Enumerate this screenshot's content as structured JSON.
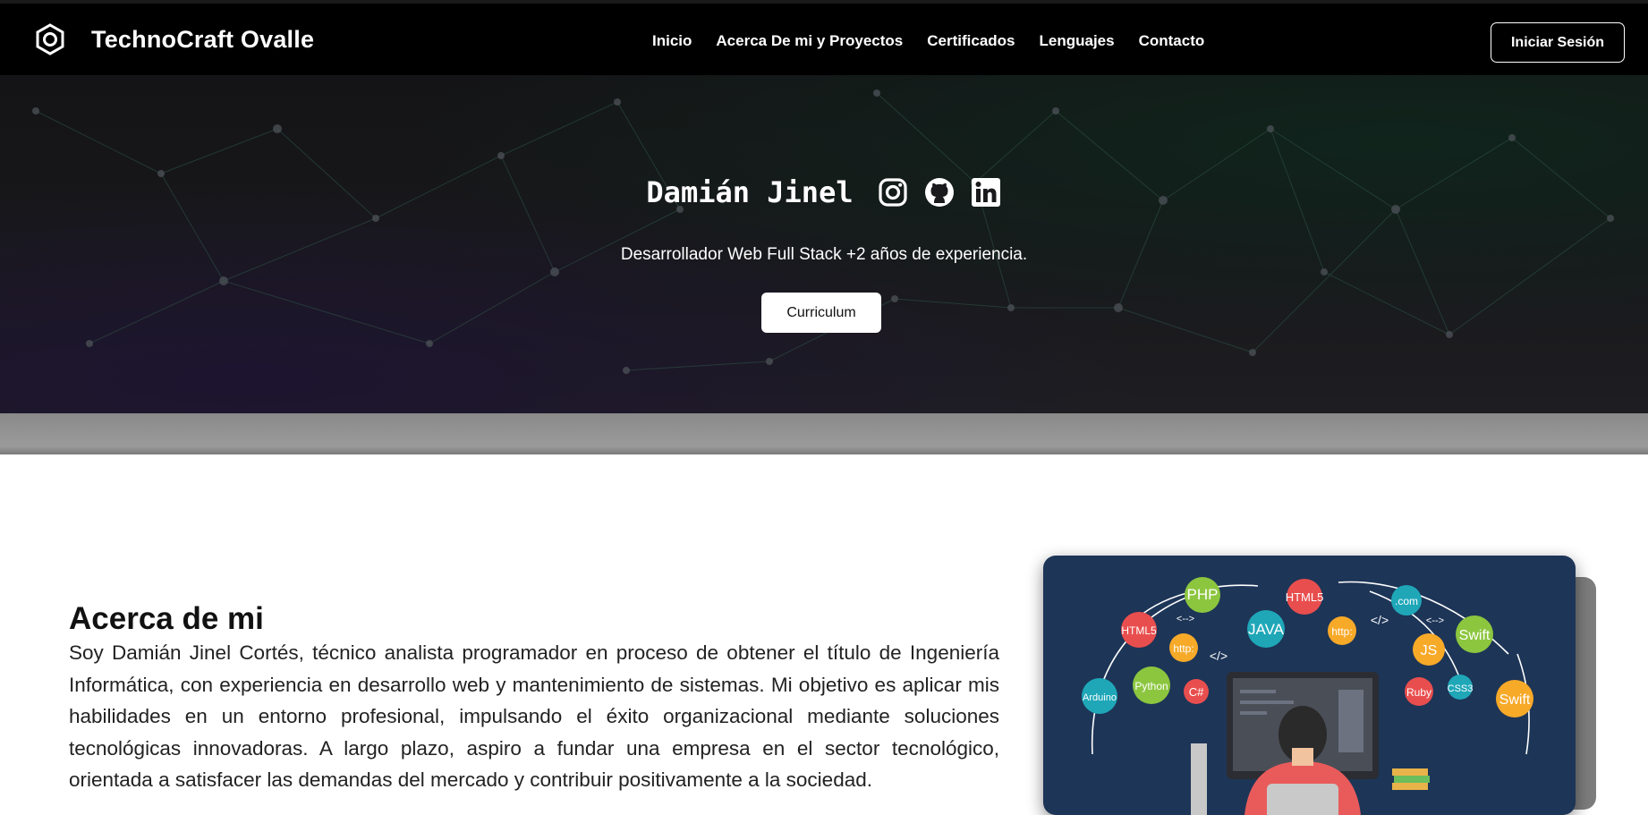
{
  "navbar": {
    "brand_name": "TechnoCraft Ovalle",
    "brand_icon": "hexagon-nut-icon",
    "links": [
      "Inicio",
      "Acerca De mi y Proyectos",
      "Certificados",
      "Lenguajes",
      "Contacto"
    ],
    "login_label": "Iniciar Sesión"
  },
  "hero": {
    "name": "Damián Jinel",
    "social_icons": [
      "instagram-icon",
      "github-icon",
      "linkedin-icon"
    ],
    "subtitle": "Desarrollador Web Full Stack +2 años de experiencia.",
    "cv_button": "Curriculum"
  },
  "about": {
    "title": "Acerca de mi",
    "text": "Soy Damián Jinel Cortés, técnico analista programador en proceso de obtener el título de Ingeniería Informática, con experiencia en desarrollo web y mantenimiento de sistemas. Mi objetivo es aplicar mis habilidades en un entorno profesional, impulsando el éxito organizacional mediante soluciones tecnológicas innovadoras. A largo plazo, aspiro a fundar una empresa en el sector tecnológico, orientada a satisfacer las demandas del mercado y contribuir positivamente a la sociedad."
  },
  "illustration": {
    "badges": [
      "PHP",
      "HTML5",
      "JAVA",
      "HTML5",
      ".com",
      "http:",
      "Python",
      "C#",
      "Arduino",
      "http:",
      "JS",
      "Swift",
      "Ruby",
      "CSS3",
      "Swift",
      "</>",
      "<-->",
      "</>",
      "<-->"
    ]
  },
  "colors": {
    "navbar_bg": "#000000",
    "illustration_bg": "#1d3557",
    "network_line": "#3a6b55"
  }
}
